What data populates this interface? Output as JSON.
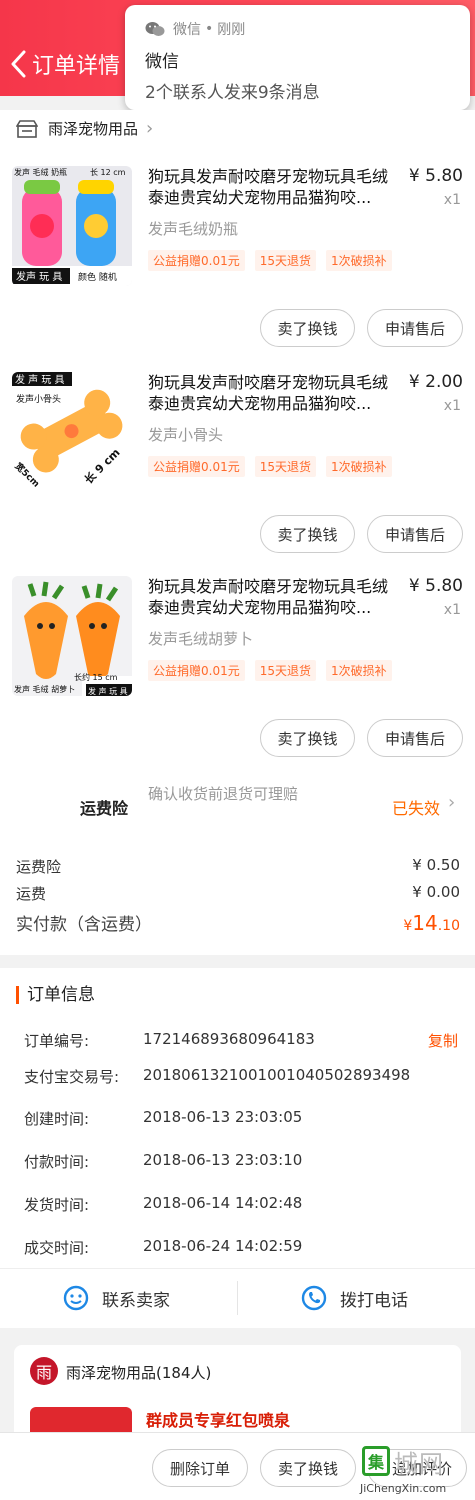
{
  "header": {
    "title": "订单详情"
  },
  "notification": {
    "app": "微信",
    "separator": "•",
    "time": "刚刚",
    "title": "微信",
    "body": "2个联系人发来9条消息"
  },
  "shop": {
    "name": "雨泽宠物用品"
  },
  "items": [
    {
      "title": "狗玩具发声耐咬磨牙宠物玩具毛绒泰迪贵宾幼犬宠物用品猫狗咬...",
      "price": "¥ 5.80",
      "qty": "x1",
      "spec": "发声毛绒奶瓶",
      "tags": [
        "公益捐赠0.01元",
        "15天退货",
        "1次破损补"
      ],
      "btn_sell": "卖了换钱",
      "btn_after": "申请售后",
      "thumb_texts": [
        "发声 毛绒 奶瓶",
        "长 12 cm",
        "发声 玩 具",
        "颜色 随机"
      ]
    },
    {
      "title": "狗玩具发声耐咬磨牙宠物玩具毛绒泰迪贵宾幼犬宠物用品猫狗咬...",
      "price": "¥ 2.00",
      "qty": "x1",
      "spec": "发声小骨头",
      "tags": [
        "公益捐赠0.01元",
        "15天退货",
        "1次破损补"
      ],
      "btn_sell": "卖了换钱",
      "btn_after": "申请售后",
      "thumb_texts": [
        "发 声 玩 具",
        "发声小骨头",
        "长 9 cm",
        "宽5cm"
      ]
    },
    {
      "title": "狗玩具发声耐咬磨牙宠物玩具毛绒泰迪贵宾幼犬宠物用品猫狗咬...",
      "price": "¥ 5.80",
      "qty": "x1",
      "spec": "发声毛绒胡萝卜",
      "tags": [
        "公益捐赠0.01元",
        "15天退货",
        "1次破损补"
      ],
      "btn_sell": "卖了换钱",
      "btn_after": "申请售后",
      "thumb_texts": [
        "长约 15 cm",
        "发声 毛绒 胡萝卜",
        "发 声 玩 具"
      ]
    }
  ],
  "insurance": {
    "label": "运费险",
    "desc": "确认收货前退货可理赔",
    "status": "已失效"
  },
  "fees": [
    {
      "label": "运费险",
      "value": "¥ 0.50"
    },
    {
      "label": "运费",
      "value": "¥ 0.00"
    }
  ],
  "total": {
    "label": "实付款（含运费）",
    "currency": "¥",
    "int": "14",
    "dec": ".10"
  },
  "order_info": {
    "title": "订单信息",
    "copy": "复制",
    "rows": [
      {
        "label": "订单编号:",
        "value": "172146893680964183"
      },
      {
        "label": "支付宝交易号:",
        "value": "2018061321001001040502893498"
      },
      {
        "label": "创建时间:",
        "value": "2018-06-13 23:03:05"
      },
      {
        "label": "付款时间:",
        "value": "2018-06-13 23:03:10"
      },
      {
        "label": "发货时间:",
        "value": "2018-06-14 14:02:48"
      },
      {
        "label": "成交时间:",
        "value": "2018-06-24 14:02:59"
      }
    ],
    "contact_seller": "联系卖家",
    "call": "拨打电话"
  },
  "group": {
    "avatar_char": "雨",
    "name": "雨泽宠物用品(184人)",
    "promo": "群成员专享红包喷泉"
  },
  "bottom": {
    "delete": "删除订单",
    "sell": "卖了换钱",
    "review": "追加评价"
  },
  "watermark": {
    "box": "集",
    "text": "城网",
    "url": "JiChengXin.com"
  },
  "colors": {
    "header": "#f5364a",
    "accent": "#ff5000",
    "tag_bg": "#fff2ec",
    "tag_fg": "#ff6a2b"
  }
}
